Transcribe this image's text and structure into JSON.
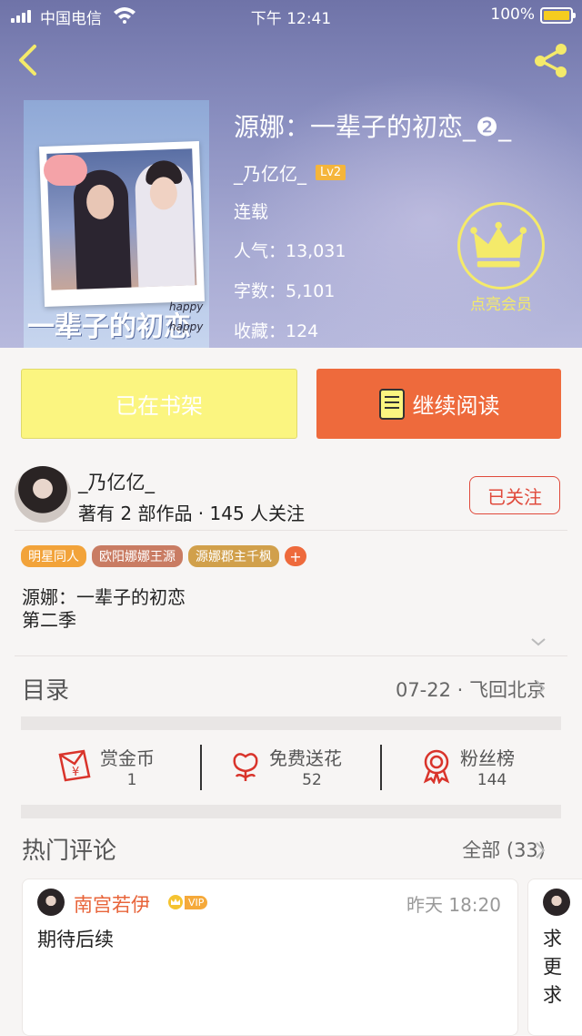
{
  "status_bar": {
    "carrier": "中国电信",
    "time": "下午 12:41",
    "battery_pct": "100%"
  },
  "book": {
    "title": "源娜：一辈子的初恋_❷_",
    "author": "_乃亿亿_",
    "author_level": "Lv2",
    "status": "连载",
    "popularity": "人气：13,031",
    "word_count": "字数：5,101",
    "favorites": "收藏：124",
    "cover_title": "一辈子的初恋",
    "cover_stamp": "happy\nhappy"
  },
  "vip": {
    "label": "点亮会员"
  },
  "actions": {
    "shelf_label": "已在书架",
    "read_label": "继续阅读"
  },
  "author_block": {
    "name": "_乃亿亿_",
    "stats": "著有 2 部作品 · 145 人关注",
    "follow_label": "已关注"
  },
  "tags": [
    {
      "label": "明星同人",
      "color": "#f2a33a"
    },
    {
      "label": "欧阳娜娜王源",
      "color": "#c97c63"
    },
    {
      "label": "源娜郡主千枫",
      "color": "#d1a04b"
    }
  ],
  "tag_add": "+",
  "description": {
    "line1": "源娜：一辈子的初恋",
    "line2": "第二季"
  },
  "toc": {
    "label": "目录",
    "latest": "07-22 · 飞回北京"
  },
  "support": [
    {
      "label": "赏金币",
      "count": "1",
      "icon": "red-envelope-icon"
    },
    {
      "label": "免费送花",
      "count": "52",
      "icon": "flower-icon"
    },
    {
      "label": "粉丝榜",
      "count": "144",
      "icon": "medal-icon"
    }
  ],
  "comments_section": {
    "title": "热门评论",
    "all_label": "全部 (33)"
  },
  "comments": [
    {
      "user": "南宫若伊",
      "badge": "VIP",
      "time": "昨天 18:20",
      "text": "期待后续"
    },
    {
      "user": "",
      "text": "求更求"
    }
  ],
  "colors": {
    "accent_orange": "#ee6a3c",
    "shelf_yellow": "#fbf580",
    "vip_yellow": "#f4ea6a",
    "follow_red": "#e04a3c"
  }
}
